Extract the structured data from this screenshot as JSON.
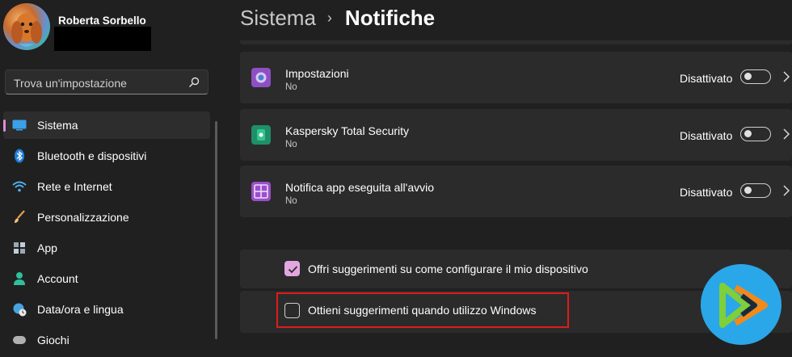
{
  "sidebar": {
    "user": {
      "name": "Roberta Sorbello"
    },
    "search": {
      "placeholder": "Trova un'impostazione",
      "icon": "search-icon"
    },
    "items": [
      {
        "label": "Sistema",
        "icon": "monitor-icon",
        "active": true
      },
      {
        "label": "Bluetooth e dispositivi",
        "icon": "bluetooth-icon"
      },
      {
        "label": "Rete e Internet",
        "icon": "wifi-icon"
      },
      {
        "label": "Personalizzazione",
        "icon": "brush-icon"
      },
      {
        "label": "App",
        "icon": "apps-icon"
      },
      {
        "label": "Account",
        "icon": "person-icon"
      },
      {
        "label": "Data/ora e lingua",
        "icon": "globe-clock-icon"
      },
      {
        "label": "Giochi",
        "icon": "gamepad-icon"
      }
    ]
  },
  "header": {
    "parent": "Sistema",
    "separator": "›",
    "current": "Notifiche"
  },
  "apps": [
    {
      "name": "Impostazioni",
      "status": "No",
      "toggle_label": "Disattivato",
      "icon": "settings-app-icon"
    },
    {
      "name": "Kaspersky Total Security",
      "status": "No",
      "toggle_label": "Disattivato",
      "icon": "kaspersky-icon"
    },
    {
      "name": "Notifica app eseguita all'avvio",
      "status": "No",
      "toggle_label": "Disattivato",
      "icon": "startup-app-icon"
    }
  ],
  "suggestions": [
    {
      "label": "Offri suggerimenti su come configurare il mio dispositivo",
      "checked": true
    },
    {
      "label": "Ottieni suggerimenti quando utilizzo Windows",
      "checked": false
    }
  ],
  "colors": {
    "background": "#202020",
    "card": "#2b2b2b",
    "accent": "#e3a7e0",
    "highlight": "#e01b1b",
    "logo_blue": "#2aa7e8",
    "logo_orange": "#f08a1c",
    "logo_green": "#7fcf3a"
  }
}
